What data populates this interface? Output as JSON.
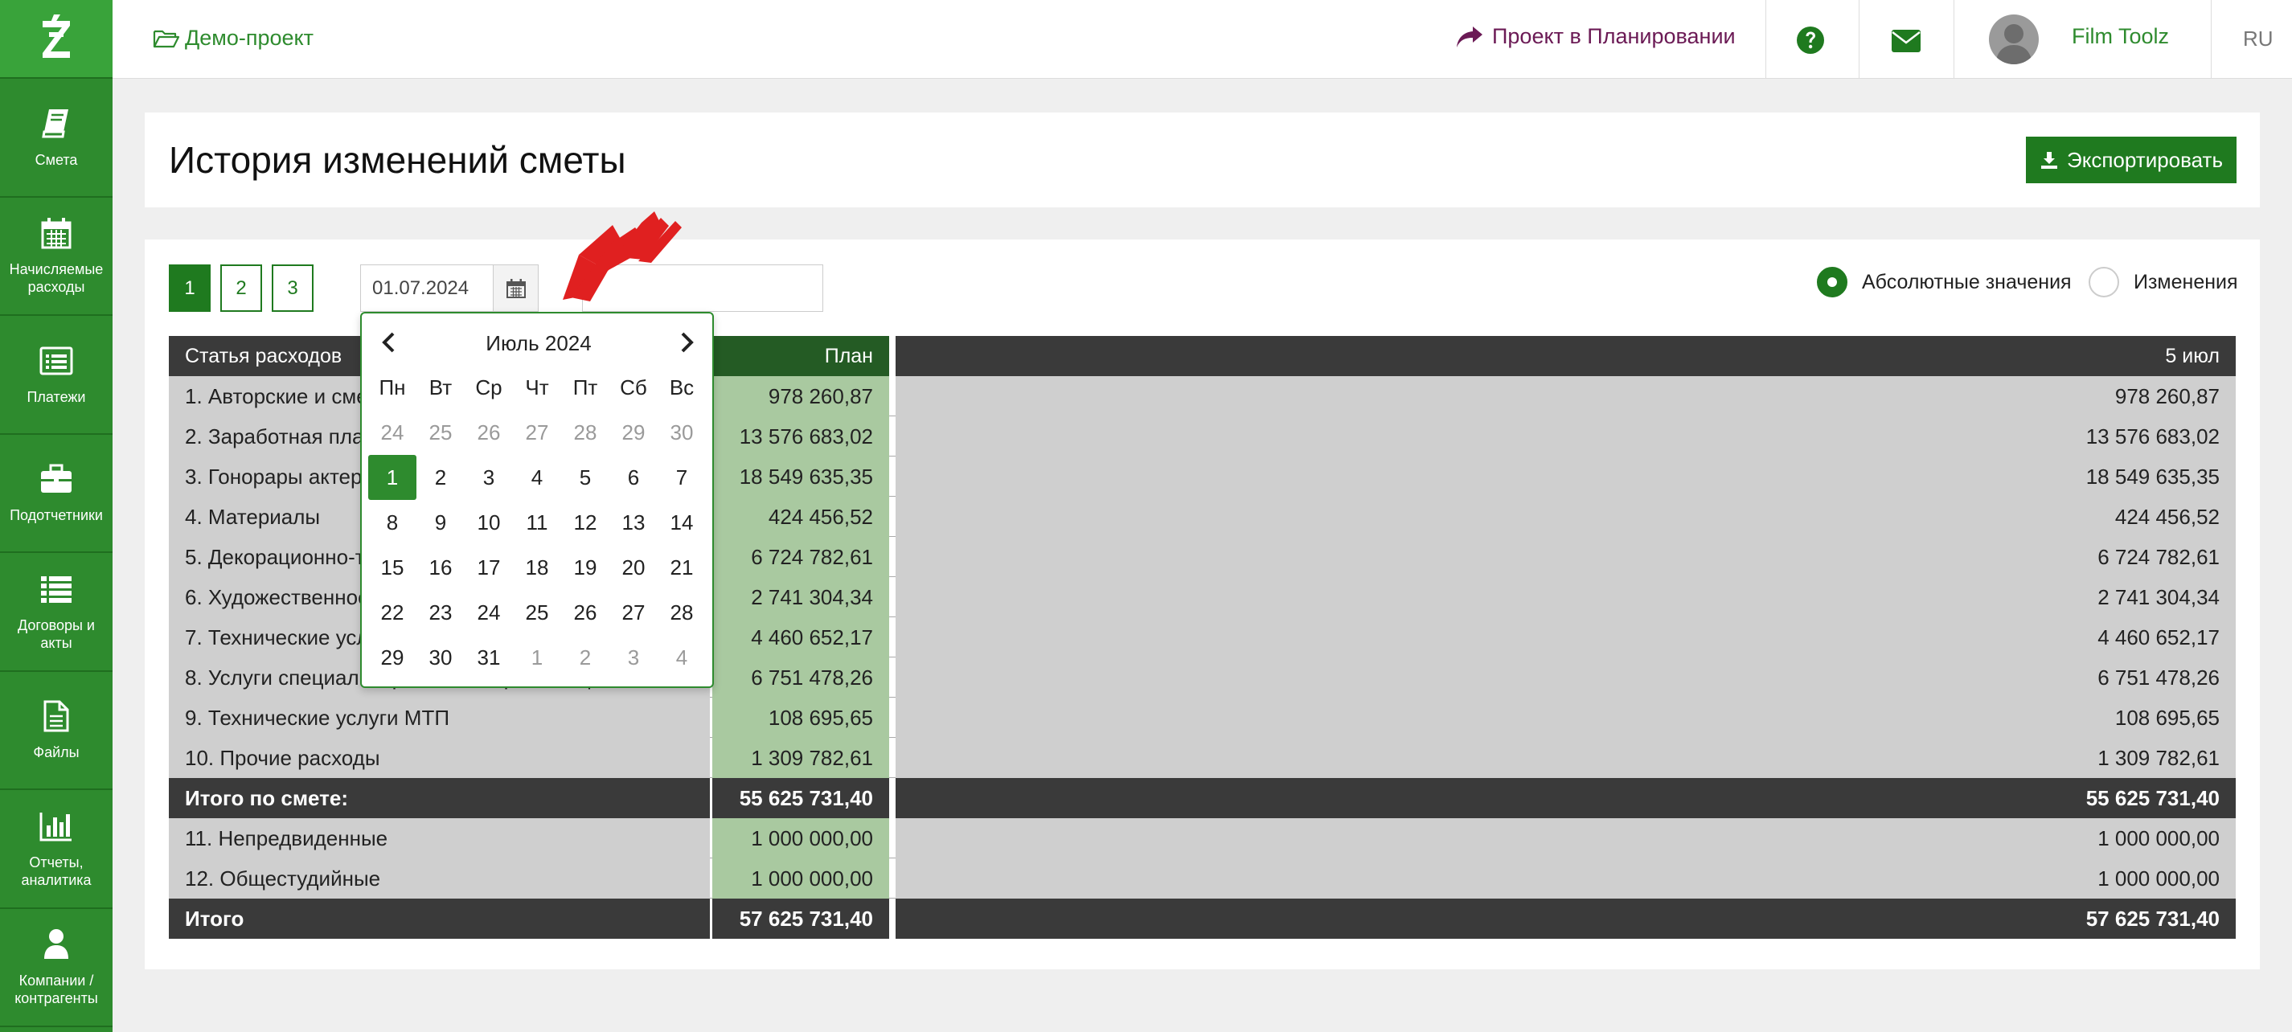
{
  "sidebar": {
    "logo": "Z",
    "items": [
      {
        "label": "Смета",
        "icon": "book-icon"
      },
      {
        "label": "Начисляемые расходы",
        "icon": "calendar-icon"
      },
      {
        "label": "Платежи",
        "icon": "list-alt-icon"
      },
      {
        "label": "Подотчетники",
        "icon": "briefcase-icon"
      },
      {
        "label": "Договоры и акты",
        "icon": "list-icon"
      },
      {
        "label": "Файлы",
        "icon": "file-icon"
      },
      {
        "label": "Отчеты, аналитика",
        "icon": "bar-chart-icon"
      },
      {
        "label": "Компании / контрагенты",
        "icon": "user-icon"
      }
    ]
  },
  "topbar": {
    "project": "Демо-проект",
    "plan_status": "Проект в Планировании",
    "user_name": "Film Toolz",
    "language": "RU"
  },
  "header": {
    "title": "История изменений сметы",
    "export_label": "Экспортировать"
  },
  "controls": {
    "pages": [
      "1",
      "2",
      "3"
    ],
    "active_page": "1",
    "date_from": "01.07.2024",
    "date_to": "",
    "radio_absolute": "Абсолютные значения",
    "radio_changes": "Изменения",
    "selected_mode": "absolute"
  },
  "table": {
    "headers": {
      "name": "Статья расходов",
      "plan": "План",
      "col1": "5 июл"
    },
    "rows": [
      {
        "name": "1. Авторские и смежные права",
        "plan": "978 260,87",
        "col1": "978 260,87",
        "type": "body"
      },
      {
        "name": "2. Заработная плата",
        "plan": "13 576 683,02",
        "col1": "13 576 683,02",
        "type": "body"
      },
      {
        "name": "3. Гонорары актеров",
        "plan": "18 549 635,35",
        "col1": "18 549 635,35",
        "type": "body"
      },
      {
        "name": "4. Материалы",
        "plan": "424 456,52",
        "col1": "424 456,52",
        "type": "body"
      },
      {
        "name": "5. Декорационно-техническое обеспечение",
        "plan": "6 724 782,61",
        "col1": "6 724 782,61",
        "type": "body"
      },
      {
        "name": "6. Художественное обеспечение",
        "plan": "2 741 304,34",
        "col1": "2 741 304,34",
        "type": "body"
      },
      {
        "name": "7. Технические услуги",
        "plan": "4 460 652,17",
        "col1": "4 460 652,17",
        "type": "body"
      },
      {
        "name": "8. Услуги специализированных организаций",
        "plan": "6 751 478,26",
        "col1": "6 751 478,26",
        "type": "body"
      },
      {
        "name": "9. Технические услуги МТП",
        "plan": "108 695,65",
        "col1": "108 695,65",
        "type": "body"
      },
      {
        "name": "10. Прочие расходы",
        "plan": "1 309 782,61",
        "col1": "1 309 782,61",
        "type": "body"
      },
      {
        "name": "Итого по смете:",
        "plan": "55 625 731,40",
        "col1": "55 625 731,40",
        "type": "total"
      },
      {
        "name": "11. Непредвиденные",
        "plan": "1 000 000,00",
        "col1": "1 000 000,00",
        "type": "body"
      },
      {
        "name": "12. Общестудийные",
        "plan": "1 000 000,00",
        "col1": "1 000 000,00",
        "type": "body"
      },
      {
        "name": "Итого",
        "plan": "57 625 731,40",
        "col1": "57 625 731,40",
        "type": "total"
      }
    ]
  },
  "calendar": {
    "month_label": "Июль 2024",
    "weekdays": [
      "Пн",
      "Вт",
      "Ср",
      "Чт",
      "Пт",
      "Сб",
      "Вс"
    ],
    "weeks": [
      [
        {
          "d": "24",
          "m": true
        },
        {
          "d": "25",
          "m": true
        },
        {
          "d": "26",
          "m": true
        },
        {
          "d": "27",
          "m": true
        },
        {
          "d": "28",
          "m": true
        },
        {
          "d": "29",
          "m": true
        },
        {
          "d": "30",
          "m": true
        }
      ],
      [
        {
          "d": "1",
          "s": true
        },
        {
          "d": "2"
        },
        {
          "d": "3"
        },
        {
          "d": "4"
        },
        {
          "d": "5"
        },
        {
          "d": "6"
        },
        {
          "d": "7"
        }
      ],
      [
        {
          "d": "8"
        },
        {
          "d": "9"
        },
        {
          "d": "10"
        },
        {
          "d": "11"
        },
        {
          "d": "12"
        },
        {
          "d": "13"
        },
        {
          "d": "14"
        }
      ],
      [
        {
          "d": "15"
        },
        {
          "d": "16"
        },
        {
          "d": "17"
        },
        {
          "d": "18"
        },
        {
          "d": "19"
        },
        {
          "d": "20"
        },
        {
          "d": "21"
        }
      ],
      [
        {
          "d": "22"
        },
        {
          "d": "23"
        },
        {
          "d": "24"
        },
        {
          "d": "25"
        },
        {
          "d": "26"
        },
        {
          "d": "27"
        },
        {
          "d": "28"
        }
      ],
      [
        {
          "d": "29"
        },
        {
          "d": "30"
        },
        {
          "d": "31"
        },
        {
          "d": "1",
          "m": true
        },
        {
          "d": "2",
          "m": true
        },
        {
          "d": "3",
          "m": true
        },
        {
          "d": "4",
          "m": true
        }
      ]
    ]
  },
  "colors": {
    "brand_green": "#2e8b2e",
    "dark_header": "#3a3a3a",
    "plan_column": "#a9c9a0",
    "annotation_red": "#e02020"
  }
}
